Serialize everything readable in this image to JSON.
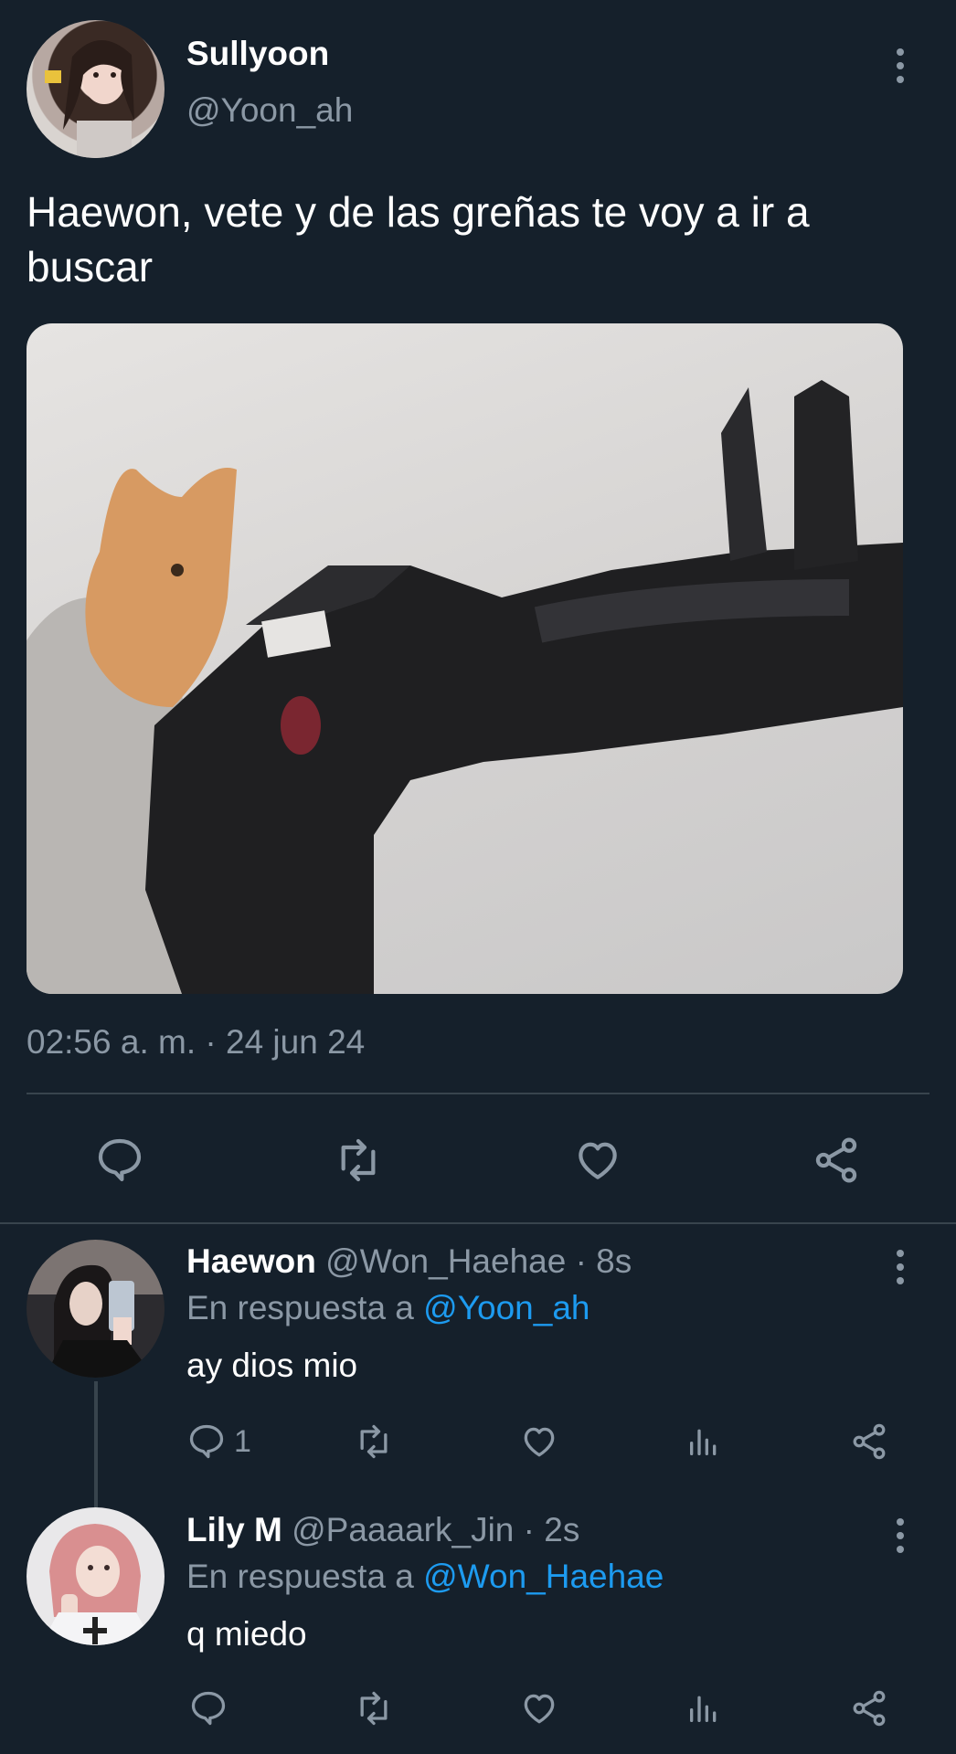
{
  "main_tweet": {
    "author_name": "Sullyoon",
    "handle": "@Yoon_ah",
    "text": "Haewon, vete y de las greñas te voy a ir a buscar",
    "timestamp": "02:56 a. m. · 24 jun 24",
    "media_icon": "photo",
    "actions": [
      "reply-icon",
      "retweet-icon",
      "like-icon",
      "share-icon"
    ]
  },
  "replies": [
    {
      "author_name": "Haewon",
      "handle": "@Won_Haehae",
      "time": "· 8s",
      "in_reply_prefix": "En respuesta a",
      "in_reply_handle": "@Yoon_ah",
      "text": "ay dios mio",
      "reply_count": "1"
    },
    {
      "author_name": "Lily M",
      "handle": "@Paaaark_Jin",
      "time": "· 2s",
      "in_reply_prefix": "En respuesta a",
      "in_reply_handle": "@Won_Haehae",
      "text": "q miedo",
      "reply_count": ""
    }
  ],
  "colors": {
    "background": "#15202b",
    "muted_text": "#8b98a5",
    "link": "#1d9bf0",
    "divider": "#38444d"
  }
}
